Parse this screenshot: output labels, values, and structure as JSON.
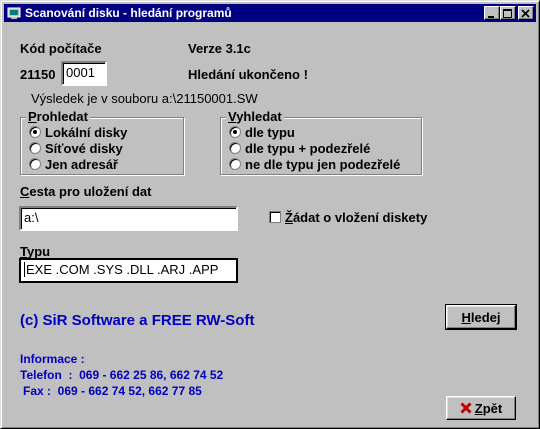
{
  "window": {
    "title": "Scanování disku - hledání programů",
    "minimize_icon": "minimize-icon",
    "maximize_icon": "maximize-icon",
    "close_icon": "close-icon"
  },
  "computer": {
    "label": "Kód počítače",
    "prefix": "21150",
    "code": "0001"
  },
  "version": "Verze 3.1c",
  "status": "Hledání ukončeno !",
  "result_text": "Výsledek je v souboru a:\\21150001.SW",
  "scan_group": {
    "legend_first": "P",
    "legend_rest": "rohledat",
    "options": [
      "Lokální disky",
      "Síťové disky",
      "Jen adresář"
    ],
    "selected": 0
  },
  "search_group": {
    "legend_first": "V",
    "legend_rest": "yhledat",
    "options": [
      "dle typu",
      "dle typu + podezřelé",
      "ne dle typu jen podezřelé"
    ],
    "selected": 0
  },
  "path": {
    "label_first": "C",
    "label_rest": "esta pro uložení dat",
    "value": "a:\\"
  },
  "diskette": {
    "label_first": "Ž",
    "label_rest": "ádat o vložení diskety",
    "checked": false
  },
  "types": {
    "label_first": "T",
    "label_rest": "ypu",
    "value": "EXE .COM .SYS .DLL .ARJ .APP"
  },
  "copyright": "(c) SiR Software a FREE RW-Soft",
  "contact": {
    "heading": "Informace :",
    "phone": "Telefon  :  069 - 662 25 86, 662 74 52",
    "fax": "Fax :  069 - 662 74 52, 662 77 85"
  },
  "buttons": {
    "search_first": "H",
    "search_rest": "ledej",
    "back_first": "Z",
    "back_rest": "pět",
    "back_icon": "x-icon"
  },
  "colors": {
    "titlebar": "#000080",
    "info_text": "#0000c0",
    "back_icon": "#c00000"
  }
}
